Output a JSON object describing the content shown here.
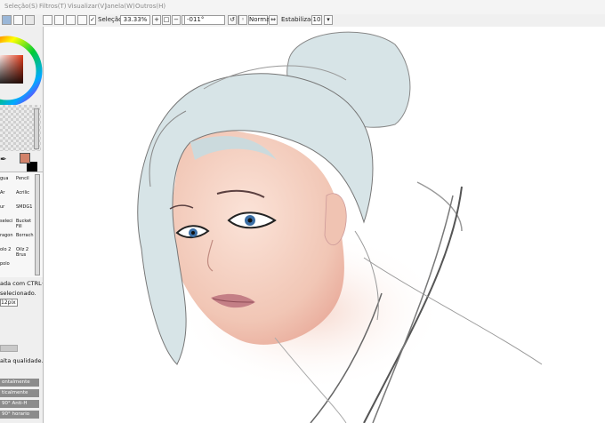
{
  "menu": [
    {
      "label": "Seleção(S)"
    },
    {
      "label": "Filtros(T)"
    },
    {
      "label": "Visualizar(V)"
    },
    {
      "label": "Janela(W)"
    },
    {
      "label": "Outros(H)"
    }
  ],
  "toolbar": {
    "selection_label": "Seleção",
    "zoom": "33.33%",
    "rotation": "-011°",
    "blend_mode": "Normal",
    "stabilizer_label": "Estabilizador",
    "stabilizer_value": "10"
  },
  "colors": {
    "primary": "#d2826a",
    "secondary": "#000000",
    "hair": "#d7e4e7",
    "skin": "#f3d1c2"
  },
  "brushes": {
    "r0": [
      "gua",
      "Pencil"
    ],
    "r1": [
      "Ar",
      "Acrilic"
    ],
    "r2": [
      "ur",
      "SMDG1"
    ],
    "r3": [
      "seleci",
      "Bucket"
    ],
    "r3b": [
      "",
      "Fill"
    ],
    "r4": [
      "ragon",
      "Borrach"
    ],
    "r5": [
      "olo 2",
      "Oilz 2"
    ],
    "r5b": [
      "nt",
      "Brus"
    ],
    "r6": [
      "polo",
      ""
    ]
  },
  "panel": {
    "hint1": "ada com CTRL+LB",
    "hint2": "selecionado.",
    "size_value": "12pix",
    "quality_text": "alta qualidade.",
    "buttons": [
      "ontalmente",
      "ticalmente",
      "90° Anti-H",
      "90° horario"
    ]
  }
}
